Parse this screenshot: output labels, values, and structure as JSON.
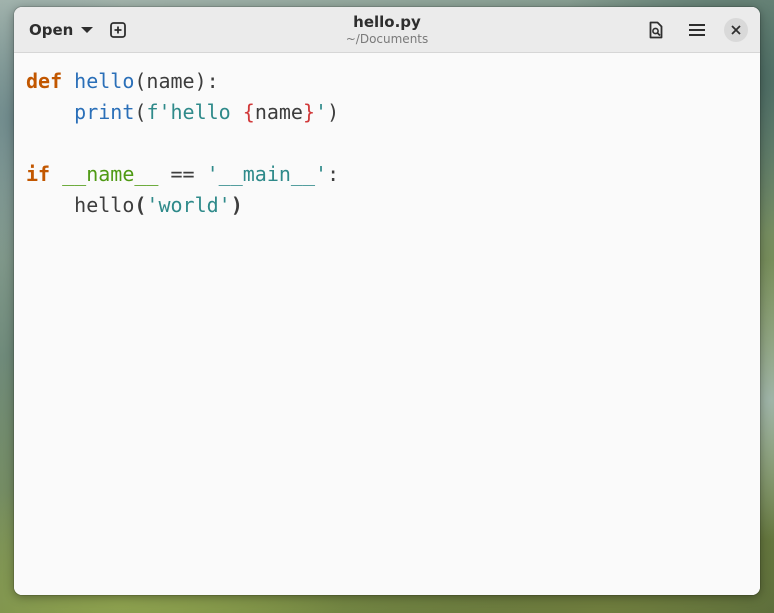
{
  "header": {
    "open_label": "Open",
    "title": "hello.py",
    "subtitle": "~/Documents",
    "icons": {
      "open_dropdown": "chevron-down-icon",
      "new_tab": "new-tab-icon",
      "document": "document-search-icon",
      "menu": "hamburger-menu-icon",
      "close": "close-icon"
    }
  },
  "editor": {
    "lines": [
      [
        {
          "t": "def",
          "c": "kw"
        },
        {
          "t": " ",
          "c": "plain"
        },
        {
          "t": "hello",
          "c": "fn"
        },
        {
          "t": "(name):",
          "c": "plain"
        }
      ],
      [
        {
          "t": "    ",
          "c": "plain"
        },
        {
          "t": "print",
          "c": "bi"
        },
        {
          "t": "(",
          "c": "plain"
        },
        {
          "t": "f'hello ",
          "c": "str"
        },
        {
          "t": "{",
          "c": "brace"
        },
        {
          "t": "name",
          "c": "plain"
        },
        {
          "t": "}",
          "c": "brace"
        },
        {
          "t": "'",
          "c": "str"
        },
        {
          "t": ")",
          "c": "plain"
        }
      ],
      [],
      [
        {
          "t": "if",
          "c": "kw"
        },
        {
          "t": " ",
          "c": "plain"
        },
        {
          "t": "__name__",
          "c": "dunder"
        },
        {
          "t": " == ",
          "c": "plain"
        },
        {
          "t": "'__main__'",
          "c": "str"
        },
        {
          "t": ":",
          "c": "plain"
        }
      ],
      [
        {
          "t": "    hello",
          "c": "plain"
        },
        {
          "t": "(",
          "c": "bold"
        },
        {
          "t": "'world'",
          "c": "str"
        },
        {
          "t": ")",
          "c": "bold"
        }
      ]
    ]
  },
  "colors": {
    "keyword": "#c25700",
    "function": "#2a6fb8",
    "string": "#2f8a8a",
    "brace": "#d1393a",
    "dunder": "#4f9a14",
    "text": "#3d3d3d",
    "editor_background": "#fafafa",
    "headerbar_background": "#ebebeb"
  }
}
